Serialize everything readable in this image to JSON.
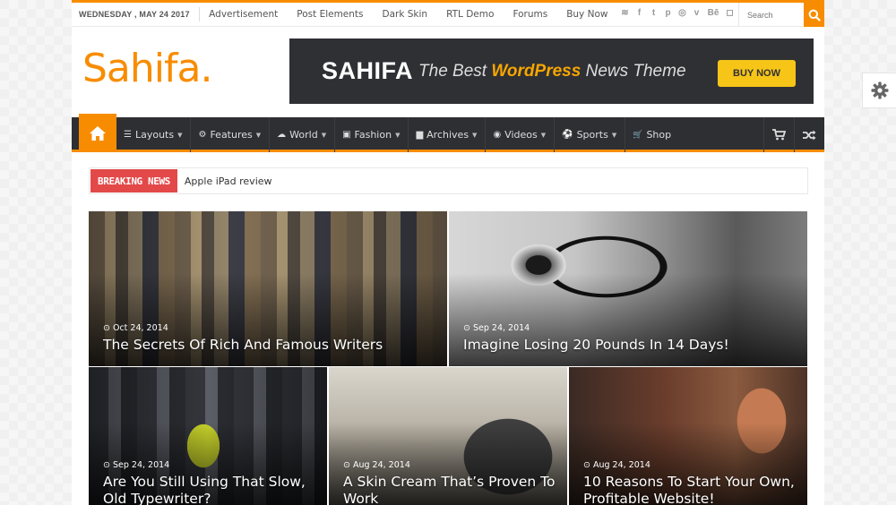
{
  "topbar": {
    "date": "WEDNESDAY , MAY 24 2017",
    "links": [
      "Advertisement",
      "Post Elements",
      "Dark Skin",
      "RTL Demo",
      "Forums",
      "Buy Now"
    ],
    "social_icons": [
      "rss-icon",
      "facebook-icon",
      "twitter-icon",
      "pinterest-icon",
      "dribbble-icon",
      "vimeo-icon",
      "behance-icon",
      "instagram-icon"
    ],
    "social_glyphs": [
      "≋",
      "f",
      "t",
      "p",
      "◎",
      "v",
      "Bē",
      "◻"
    ],
    "search_placeholder": "Search"
  },
  "header": {
    "logo_main": "Sahifa",
    "logo_dot": ".",
    "banner": {
      "brand": "SAHIFA",
      "tagline_pre": "The Best",
      "tagline_highlight": "WordPress",
      "tagline_post": "News Theme",
      "button": "BUY NOW"
    }
  },
  "nav": {
    "items": [
      {
        "label": "Layouts",
        "icon": "list-icon",
        "glyph": "☰"
      },
      {
        "label": "Features",
        "icon": "cogs-icon",
        "glyph": "⚙"
      },
      {
        "label": "World",
        "icon": "cloud-icon",
        "glyph": "☁"
      },
      {
        "label": "Fashion",
        "icon": "briefcase-icon",
        "glyph": "▣"
      },
      {
        "label": "Archives",
        "icon": "folder-icon",
        "glyph": "▆"
      },
      {
        "label": "Videos",
        "icon": "play-circle-icon",
        "glyph": "◉"
      },
      {
        "label": "Sports",
        "icon": "soccer-ball-icon",
        "glyph": "⚽"
      },
      {
        "label": "Shop",
        "icon": "cart-icon",
        "glyph": "🛒"
      }
    ]
  },
  "breaking": {
    "label": "BREAKING NEWS",
    "headline": "Apple iPad review"
  },
  "posts": [
    {
      "date": "Oct 24, 2014",
      "title": "The Secrets Of Rich And Famous Writers"
    },
    {
      "date": "Sep 24, 2014",
      "title": "Imagine Losing 20 Pounds In 14 Days!"
    },
    {
      "date": "Sep 24, 2014",
      "title": "Are You Still Using That Slow, Old Typewriter?"
    },
    {
      "date": "Aug 24, 2014",
      "title": "A Skin Cream That’s Proven To Work"
    },
    {
      "date": "Aug 24, 2014",
      "title": "10 Reasons To Start Your Own, Profitable Website!"
    }
  ],
  "colors": {
    "accent": "#f88c00",
    "nav_bg": "#2e2f33",
    "breaking": "#e34949",
    "banner_bg": "#2f3034",
    "banner_button": "#f7c518"
  }
}
